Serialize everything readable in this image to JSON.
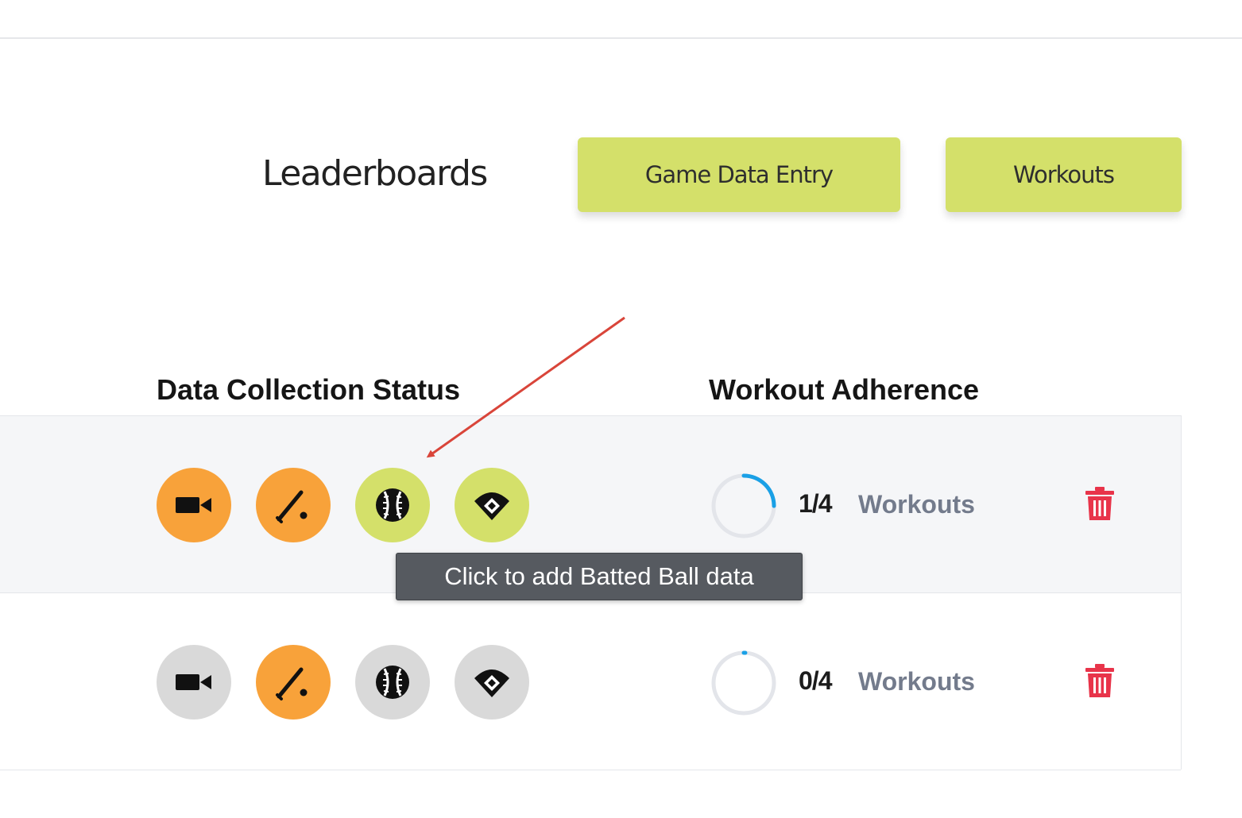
{
  "nav": {
    "title": "Leaderboards",
    "buttons": [
      {
        "label": "Game Data Entry"
      },
      {
        "label": "Workouts"
      }
    ]
  },
  "table": {
    "headers": {
      "data_collection_status": "Data Collection Status",
      "workout_adherence": "Workout Adherence"
    },
    "rows": [
      {
        "status_icons": [
          {
            "name": "video-camera-icon",
            "color": "#f8a23a",
            "active": true
          },
          {
            "name": "baseball-bat-icon",
            "color": "#f8a23a",
            "active": true
          },
          {
            "name": "baseball-icon",
            "color": "#d4e06a",
            "active": true
          },
          {
            "name": "baseball-diamond-icon",
            "color": "#d4e06a",
            "active": true
          }
        ],
        "workouts_completed": 1,
        "workouts_total": 4,
        "workout_count": "1/4",
        "workout_label": "Workouts"
      },
      {
        "status_icons": [
          {
            "name": "video-camera-icon",
            "color": "#d9d9d9",
            "active": false
          },
          {
            "name": "baseball-bat-icon",
            "color": "#f8a23a",
            "active": true
          },
          {
            "name": "baseball-icon",
            "color": "#d9d9d9",
            "active": false
          },
          {
            "name": "baseball-diamond-icon",
            "color": "#d9d9d9",
            "active": false
          }
        ],
        "workouts_completed": 0,
        "workouts_total": 4,
        "workout_count": "0/4",
        "workout_label": "Workouts"
      }
    ]
  },
  "tooltip": {
    "text": "Click to add Batted Ball data"
  },
  "colors": {
    "accent_green": "#d4e06a",
    "accent_orange": "#f8a23a",
    "inactive_gray": "#d9d9d9",
    "progress_blue": "#1aa0e6",
    "delete_red": "#e8344a",
    "annotation_red": "#d9453a"
  }
}
